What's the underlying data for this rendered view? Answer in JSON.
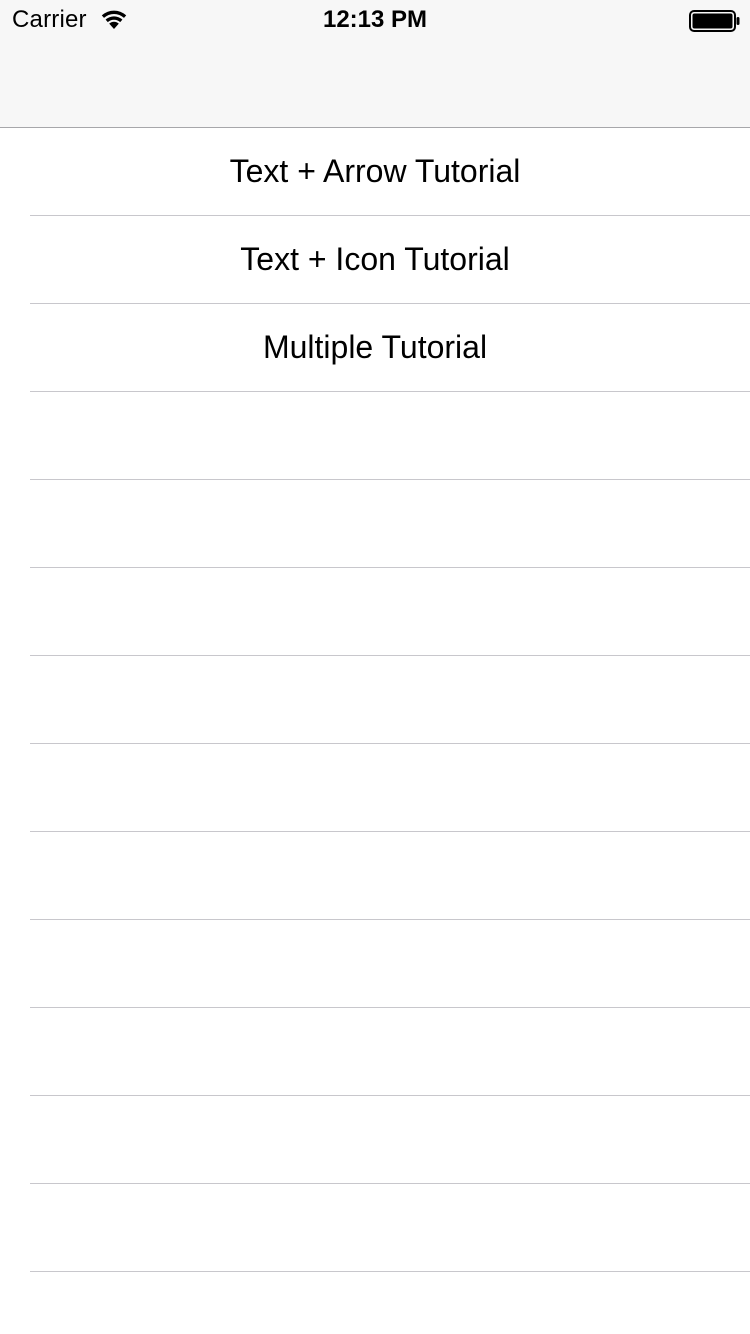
{
  "status_bar": {
    "carrier": "Carrier",
    "time": "12:13 PM",
    "wifi_icon": "wifi-icon",
    "battery_icon": "battery-full-icon"
  },
  "navigation_bar": {
    "title": ""
  },
  "table": {
    "rows": [
      {
        "label": "Text + Arrow Tutorial"
      },
      {
        "label": "Text + Icon Tutorial"
      },
      {
        "label": "Multiple Tutorial"
      },
      {
        "label": ""
      },
      {
        "label": ""
      },
      {
        "label": ""
      },
      {
        "label": ""
      },
      {
        "label": ""
      },
      {
        "label": ""
      },
      {
        "label": ""
      },
      {
        "label": ""
      },
      {
        "label": ""
      },
      {
        "label": ""
      }
    ]
  },
  "colors": {
    "nav_background": "#f7f7f7",
    "separator": "#c8c7cc",
    "text": "#000000",
    "background": "#ffffff"
  }
}
